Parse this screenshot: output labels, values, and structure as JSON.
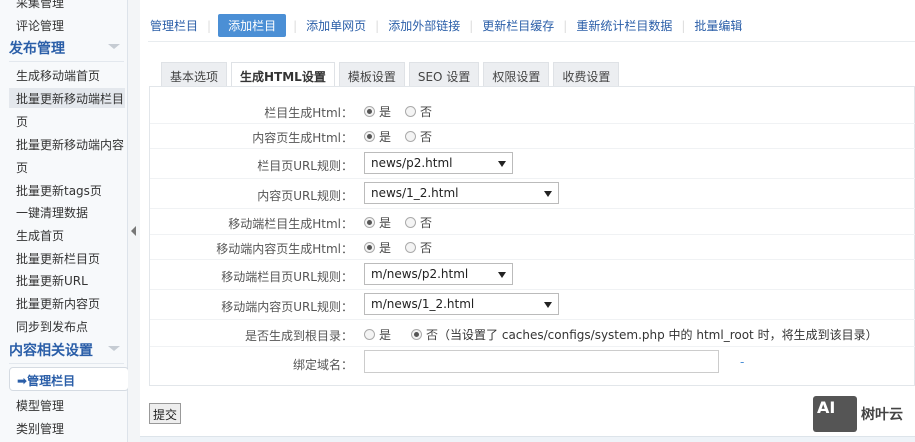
{
  "sidebar": {
    "items_top": [
      "采集管理",
      "评论管理"
    ],
    "section_publish": "发布管理",
    "publish_items": [
      "生成移动端首页",
      "批量更新移动端栏目",
      "页",
      "批量更新移动端内容",
      "页",
      "批量更新tags页",
      "一键清理数据",
      "生成首页",
      "批量更新栏目页",
      "批量更新URL",
      "批量更新内容页",
      "同步到发布点"
    ],
    "section_content": "内容相关设置",
    "active_item": "管理栏目",
    "content_items": [
      "模型管理",
      "类别管理"
    ]
  },
  "topnav": [
    "管理栏目",
    "添加栏目",
    "添加单网页",
    "添加外部链接",
    "更新栏目缓存",
    "重新统计栏目数据",
    "批量编辑"
  ],
  "tabs": [
    "基本选项",
    "生成HTML设置",
    "模板设置",
    "SEO 设置",
    "权限设置",
    "收费设置"
  ],
  "form": {
    "yes": "是",
    "no": "否",
    "rows": [
      {
        "label": "栏目生成Html：",
        "type": "radio",
        "value": "是"
      },
      {
        "label": "内容页生成Html：",
        "type": "radio",
        "value": "是"
      },
      {
        "label": "栏目页URL规则：",
        "type": "select",
        "value": "news/p2.html"
      },
      {
        "label": "内容页URL规则：",
        "type": "select",
        "value": "news/1_2.html"
      },
      {
        "label": "移动端栏目生成Html：",
        "type": "radio",
        "value": "是"
      },
      {
        "label": "移动端内容页生成Html：",
        "type": "radio",
        "value": "是"
      },
      {
        "label": "移动端栏目页URL规则：",
        "type": "select",
        "value": "m/news/p2.html"
      },
      {
        "label": "移动端内容页URL规则：",
        "type": "select",
        "value": "m/news/1_2.html"
      },
      {
        "label": "是否生成到根目录：",
        "type": "radio",
        "value": "否",
        "note": "（当设置了 caches/configs/system.php 中的 html_root 时，将生成到该目录）"
      },
      {
        "label": "绑定域名：",
        "type": "text",
        "value": "",
        "hint": "-"
      }
    ]
  },
  "submit_label": "提交",
  "watermark": "树叶云"
}
